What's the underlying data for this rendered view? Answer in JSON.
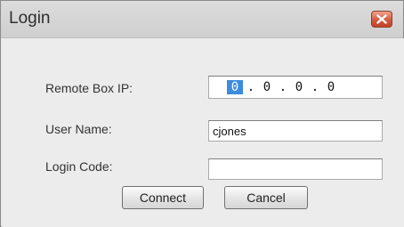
{
  "window": {
    "title": "Login",
    "close_icon": "close-x-icon"
  },
  "form": {
    "remote_ip": {
      "label": "Remote Box IP:",
      "octets": [
        "0",
        "0",
        "0",
        "0"
      ],
      "separator": "."
    },
    "user_name": {
      "label": "User Name:",
      "value": "cjones"
    },
    "login_code": {
      "label": "Login Code:",
      "value": ""
    }
  },
  "buttons": {
    "connect": "Connect",
    "cancel": "Cancel"
  },
  "colors": {
    "selection": "#3c8ce0",
    "close_button": "#d35a3e"
  }
}
